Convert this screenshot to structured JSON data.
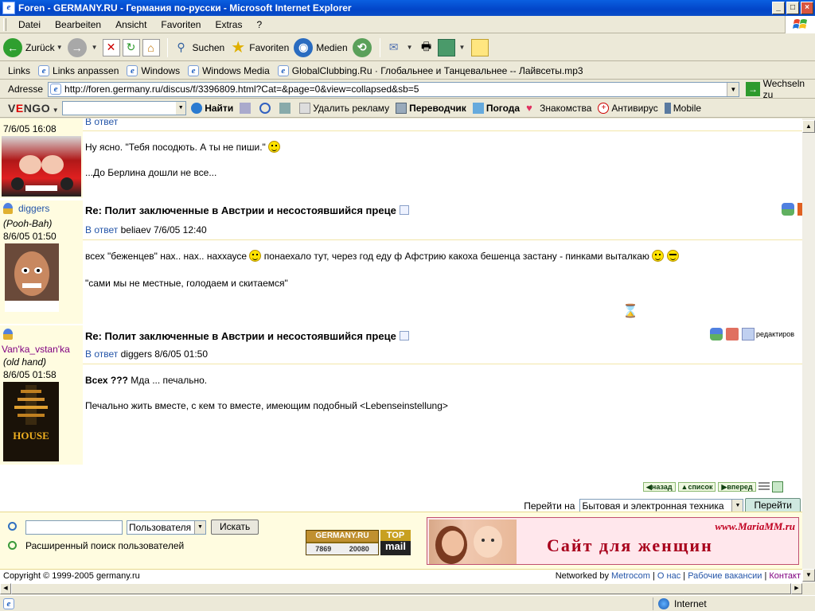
{
  "window": {
    "title": "Foren - GERMANY.RU - Германия по-русски - Microsoft Internet Explorer",
    "btn_min": "_",
    "btn_max": "□",
    "btn_close": "×"
  },
  "menu": [
    "Datei",
    "Bearbeiten",
    "Ansicht",
    "Favoriten",
    "Extras",
    "?"
  ],
  "toolbar": {
    "back": "Zurück",
    "search": "Suchen",
    "favorites": "Favoriten",
    "media": "Medien"
  },
  "links": {
    "label": "Links",
    "items": [
      "Links anpassen",
      "Windows",
      "Windows Media",
      "GlobalClubbing.Ru · Глобальнее и Танцевальнее -- Лайвсеты.mp3"
    ]
  },
  "address": {
    "label": "Adresse",
    "url": "http://foren.germany.ru/discus/f/3396809.html?Cat=&page=0&view=collapsed&sb=5",
    "go": "Wechseln zu"
  },
  "vengo": {
    "logo_pre": "V",
    "logo_mid": "E",
    "logo_post": "NGO",
    "search": "Найти",
    "remove_ads": "Удалить рекламу",
    "translator": "Переводчик",
    "weather": "Погода",
    "dating": "Знакомства",
    "antivirus": "Антивирус",
    "mobile": "Mobile"
  },
  "posts": [
    {
      "date": "7/6/05 16:08",
      "reply_partial": "В ответ",
      "lines": [
        "Ну ясно. \"Тебя посодють. А ты не пиши.\"",
        "...До Берлина дошли не все..."
      ]
    },
    {
      "user": "diggers",
      "rank": "(Pooh-Bah)",
      "date": "8/6/05 01:50",
      "title": "Re: Полит заключенные в Австрии и несостоявшийся преце",
      "reply_label": "В ответ",
      "reply_to": "beliaev 7/6/05 12:40",
      "line1a": "всех \"беженцев\" нах.. нах.. наххаусе",
      "line1b": "понаехало тут, через год еду ф Афстрию какоха бешенца застану - пинками выталкаю",
      "line2": "\"сами мы не местные, голодаем и скитаемся\""
    },
    {
      "user": "Van'ka_vstan'ka",
      "rank": "(old hand)",
      "date": "8/6/05 01:58",
      "title": "Re: Полит заключенные в Австрии и несостоявшийся преце",
      "reply_label": "В ответ",
      "reply_to": "diggers 8/6/05 01:50",
      "line1_bold": "Всех ???",
      "line1_rest": " Мда ... печально.",
      "line2": "Печально жить вместе, с кем то вместе, имеющим подобный <Lebenseinstellung>",
      "edit": "редактиров",
      "avatar_text": "HOUSE"
    }
  ],
  "nav": {
    "back": "назад",
    "list": "список",
    "forward": "вперед",
    "jump_label": "Перейти на",
    "jump_value": "Бытовая и электронная техника",
    "jump_btn": "Перейти"
  },
  "search": {
    "select": "Пользователя",
    "button": "Искать",
    "advanced": "Расширенный поиск пользователей"
  },
  "badges": {
    "germany": "GERMANY.RU",
    "g_n1": "7869",
    "g_n2": "20080",
    "topmail_1": "TOP",
    "topmail_2": "mail"
  },
  "banner": {
    "url": "www.MariaMM.ru",
    "title": "Сайт для женщин"
  },
  "footer": {
    "copyright": "Copyright © 1999-2005 germany.ru",
    "networked": "Networked by",
    "metrocom": "Metrocom",
    "about": "О нас",
    "jobs": "Рабочие вакансии",
    "contact": "Контакт"
  },
  "status": {
    "zone": "Internet"
  }
}
